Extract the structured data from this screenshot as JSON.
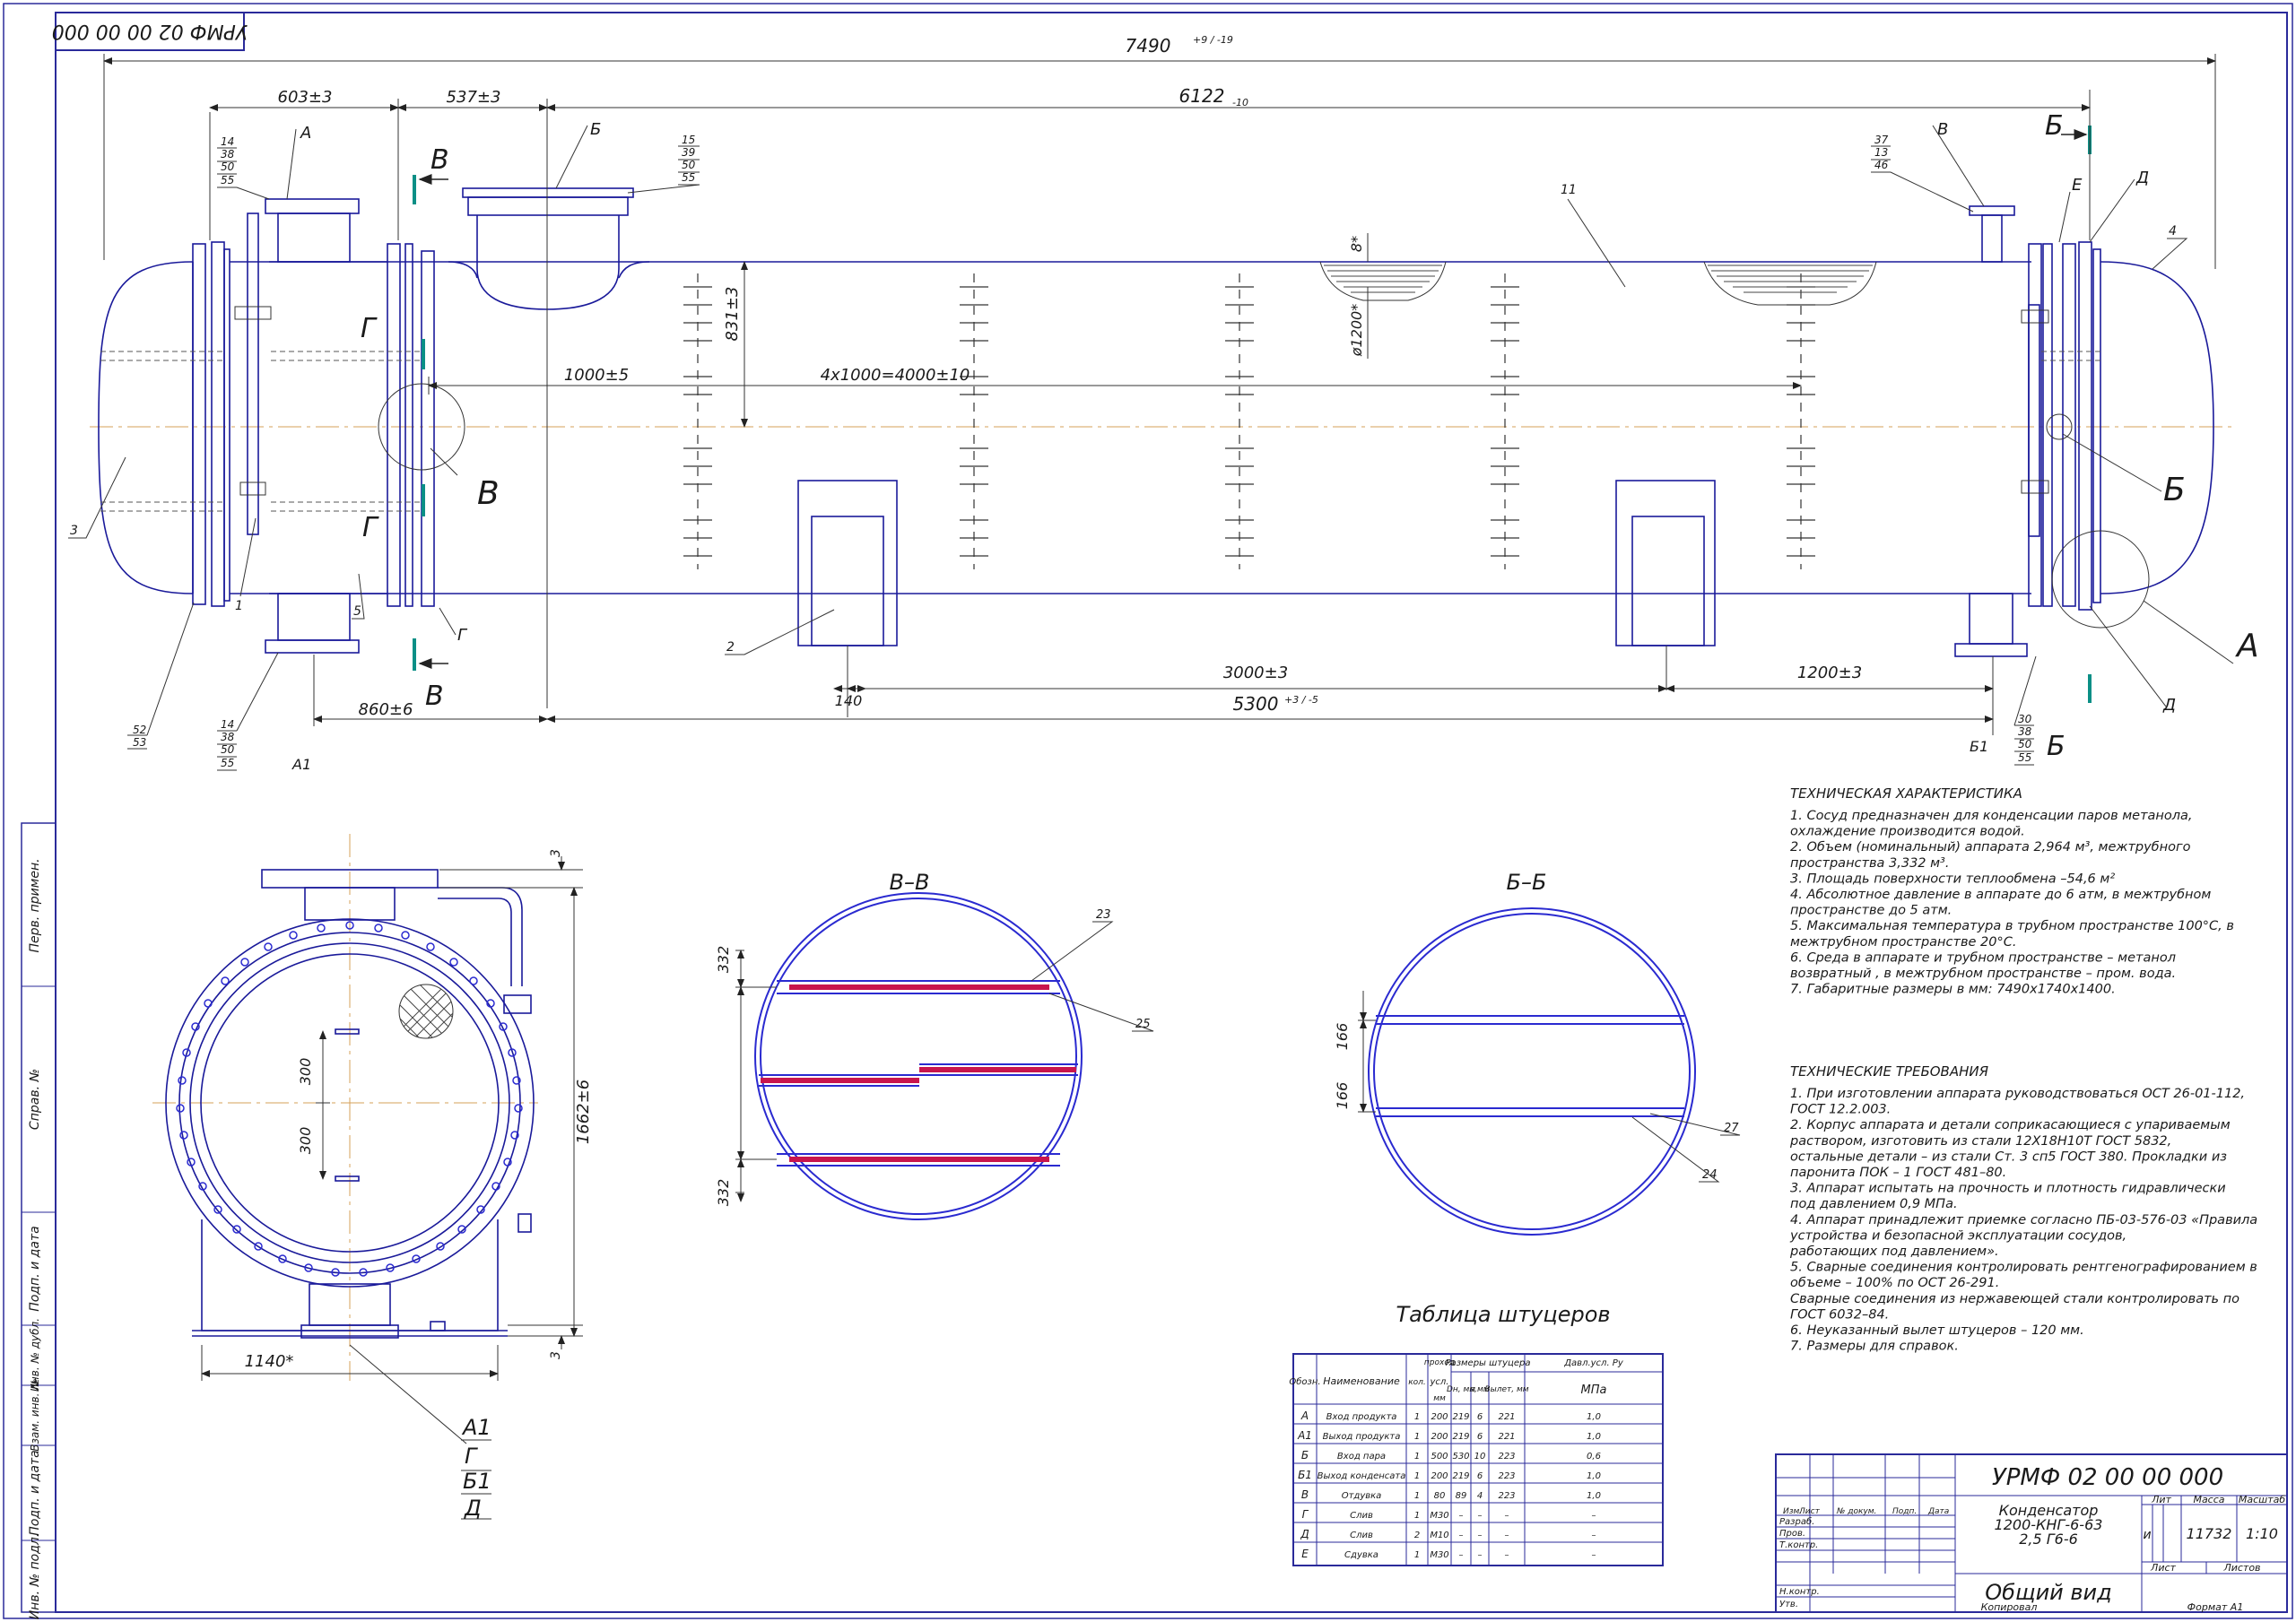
{
  "doc": {
    "code": "УРМФ 02 00 00 000",
    "stamp_code_rotated": "УРМФ 02 00 00 000",
    "name_lines": [
      "Конденсатор",
      "1200-КНГ-6-63",
      "2,5 Г6-6"
    ],
    "view": "Общий вид",
    "lit": "Лит",
    "lit_value": "и",
    "mass_label": "Масса",
    "mass_value": "11732",
    "scale_label": "Масштаб",
    "scale_value": "1:10",
    "sheet": "Лист",
    "sheets": "Листов",
    "copied": "Копировал",
    "format": "Формат  А1",
    "title_rows": [
      "Изм.",
      "Лист",
      "№ докум.",
      "Подп.",
      "Дата"
    ],
    "roles": [
      "Разраб.",
      "Пров.",
      "Т.контр.",
      "",
      "Н.контр.",
      "Утв."
    ]
  },
  "side_stamp": [
    "Инв. № подл.",
    "Подп. и дата",
    "Взам. инв. №",
    "Инв. № дубл.",
    "Подп. и дата",
    "Справ. №",
    "Перв. примен."
  ],
  "dims": {
    "overall": "7490",
    "overall_tol": "+9 / -19",
    "d603": "603±3",
    "d537": "537±3",
    "d6122": "6122",
    "d6122_tol": "-10",
    "d1000": "1000±5",
    "d4000": "4x1000=4000±10",
    "d831": "831±3",
    "d8": "8*",
    "d1200": "ø1200*",
    "d860": "860±6",
    "d140": "140",
    "d3000": "3000±3",
    "d1200b": "1200±3",
    "d5300": "5300",
    "d5300_tol": "+3 / -5",
    "d1662": "1662±6",
    "d1140": "1140*",
    "d300a": "300",
    "d300b": "300",
    "d3a": "3",
    "d3b": "3",
    "d332a": "332",
    "d332b": "332",
    "d166a": "166",
    "d166b": "166"
  },
  "labels": {
    "A": "А",
    "A1": "А1",
    "B": "Б",
    "B1": "Б1",
    "V": "В",
    "G": "Г",
    "D": "Д",
    "E": "Е",
    "sec_vv": "В–В",
    "sec_bb": "Б–Б",
    "leg_A1": "А1",
    "leg_G": "Г",
    "leg_B1": "Б1",
    "leg_D": "Д",
    "stack1": [
      "14",
      "38",
      "50",
      "55"
    ],
    "stack2": [
      "15",
      "39",
      "50",
      "55"
    ],
    "stack3": [
      "37",
      "13",
      "46"
    ],
    "stack4": [
      "14",
      "38",
      "50",
      "55"
    ],
    "stack5": [
      "52",
      "53"
    ],
    "stack6": [
      "30",
      "38",
      "50",
      "55"
    ],
    "p1": "1",
    "p2": "2",
    "p3": "3",
    "p4": "4",
    "p5": "5",
    "p11": "11",
    "p23": "23",
    "p25": "25",
    "p24": "24",
    "p27": "27"
  },
  "tech": {
    "title": "ТЕХНИЧЕСКАЯ ХАРАКТЕРИСТИКА",
    "lines": [
      "1. Сосуд предназначен для конденсации паров метанола,",
      "охлаждение производится водой.",
      "2. Объем (номинальный) аппарата 2,964 м³, межтрубного",
      "пространства 3,332 м³.",
      "3. Площадь поверхности теплообмена –54,6 м²",
      "4. Абсолютное давление в аппарате  до 6 атм, в межтрубном",
      "пространстве до 5 атм.",
      "5. Максимальная температура в трубном пространстве 100°С, в",
      "межтрубном пространстве 20°С.",
      "6. Среда в аппарате и трубном пространстве – метанол",
      "возвратный , в межтрубном пространстве – пром. вода.",
      "7. Габаритные размеры в мм: 7490х1740х1400."
    ]
  },
  "req": {
    "title": "ТЕХНИЧЕСКИЕ ТРЕБОВАНИЯ",
    "lines": [
      "1. При изготовлении аппарата руководствоваться ОСТ 26-01-112,",
      "ГОСТ 12.2.003.",
      "2. Корпус аппарата и детали соприкасающиеся с упариваемым",
      "раствором, изготовить из стали 12Х18Н10Т ГОСТ 5832,",
      "остальные  детали  – из стали Ст. 3 сп5 ГОСТ 380. Прокладки из",
      "паронита ПОК – 1 ГОСТ 481–80.",
      "3. Аппарат испытать на прочность и плотность гидравлически",
      "под давлением 0,9 МПа.",
      "4. Аппарат принадлежит приемке согласно ПБ-03-576-03 «Правила",
      "устройства и безопасной эксплуатации сосудов,",
      "работающих под давлением».",
      "5. Сварные соединения контролировать рентгенографированием в",
      "объеме – 100% по ОСТ 26-291.",
      "Сварные соединения из нержавеющей стали контролировать по",
      "ГОСТ 6032–84.",
      "6. Неуказанный вылет штуцеров – 120 мм.",
      "7. Размеры для справок."
    ]
  },
  "nozzle_table": {
    "title": "Таблица штуцеров",
    "h_obozn": "Обозн.",
    "h_name": "Наименование",
    "h_kol": "кол.",
    "h_dy_top": "проход",
    "h_dy_mid": "усл.",
    "h_dy_bot": "мм",
    "h_size": "Размеры штуцера",
    "h_dn": "Dн, мм",
    "h_s": "s,мм",
    "h_vyl": "Вылет, мм",
    "h_p": "Давл.усл. Ру",
    "h_mpa": "МПа",
    "rows": [
      {
        "o": "А",
        "n": "Вход продукта",
        "k": "1",
        "d": "200",
        "dn": "219",
        "s": "6",
        "v": "221",
        "p": "1,0"
      },
      {
        "o": "А1",
        "n": "Выход продукта",
        "k": "1",
        "d": "200",
        "dn": "219",
        "s": "6",
        "v": "221",
        "p": "1,0"
      },
      {
        "o": "Б",
        "n": "Вход пара",
        "k": "1",
        "d": "500",
        "dn": "530",
        "s": "10",
        "v": "223",
        "p": "0,6"
      },
      {
        "o": "Б1",
        "n": "Выход конденсата",
        "k": "1",
        "d": "200",
        "dn": "219",
        "s": "6",
        "v": "223",
        "p": "1,0"
      },
      {
        "o": "В",
        "n": "Отдувка",
        "k": "1",
        "d": "80",
        "dn": "89",
        "s": "4",
        "v": "223",
        "p": "1,0"
      },
      {
        "o": "Г",
        "n": "Слив",
        "k": "1",
        "d": "М30",
        "dn": "–",
        "s": "–",
        "v": "–",
        "p": "–"
      },
      {
        "o": "Д",
        "n": "Слив",
        "k": "2",
        "d": "М10",
        "dn": "–",
        "s": "–",
        "v": "–",
        "p": "–"
      },
      {
        "o": "Е",
        "n": "Сдувка",
        "k": "1",
        "d": "М30",
        "dn": "–",
        "s": "–",
        "v": "–",
        "p": "–"
      }
    ]
  }
}
